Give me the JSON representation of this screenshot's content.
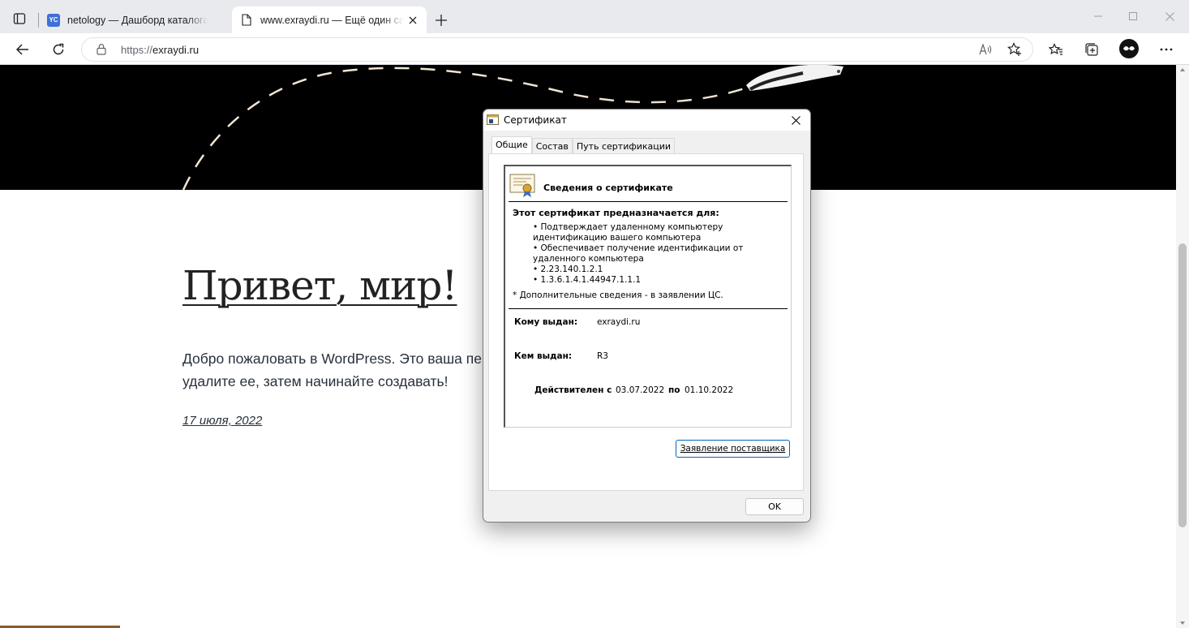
{
  "browser": {
    "tabs": [
      {
        "title": "netology — Дашборд каталога",
        "favicon": "YC",
        "active": false
      },
      {
        "title": "www.exraydi.ru — Ещё один сайт",
        "active": true
      }
    ],
    "address": {
      "prefix": "https://",
      "host": "exraydi.ru"
    }
  },
  "page": {
    "post_title": "Привет, мир!",
    "post_text": "Добро пожаловать в WordPress. Это ваша пе",
    "post_text_line2": "удалите ее, затем начинайте создавать!",
    "post_date": "17 июля, 2022"
  },
  "dialog": {
    "title": "Сертификат",
    "tabs": [
      "Общие",
      "Состав",
      "Путь сертификации"
    ],
    "info_heading": "Сведения о сертификате",
    "purpose_heading": "Этот сертификат предназначается для:",
    "purposes": [
      "• Подтверждает удаленному компьютеру идентификацию вашего компьютера",
      "• Обеспечивает получение идентификации от удаленного компьютера",
      "• 2.23.140.1.2.1",
      "• 1.3.6.1.4.1.44947.1.1.1"
    ],
    "more_info": "* Дополнительные сведения - в заявлении ЦС.",
    "issued_to_label": "Кому выдан:",
    "issued_to": "exraydi.ru",
    "issued_by_label": "Кем выдан:",
    "issued_by": "R3",
    "valid_from_label": "Действителен с",
    "valid_from": "03.07.2022",
    "valid_to_label": "по",
    "valid_to": "01.10.2022",
    "issuer_statement_button": "Заявление поставщика",
    "ok_button": "OK"
  }
}
